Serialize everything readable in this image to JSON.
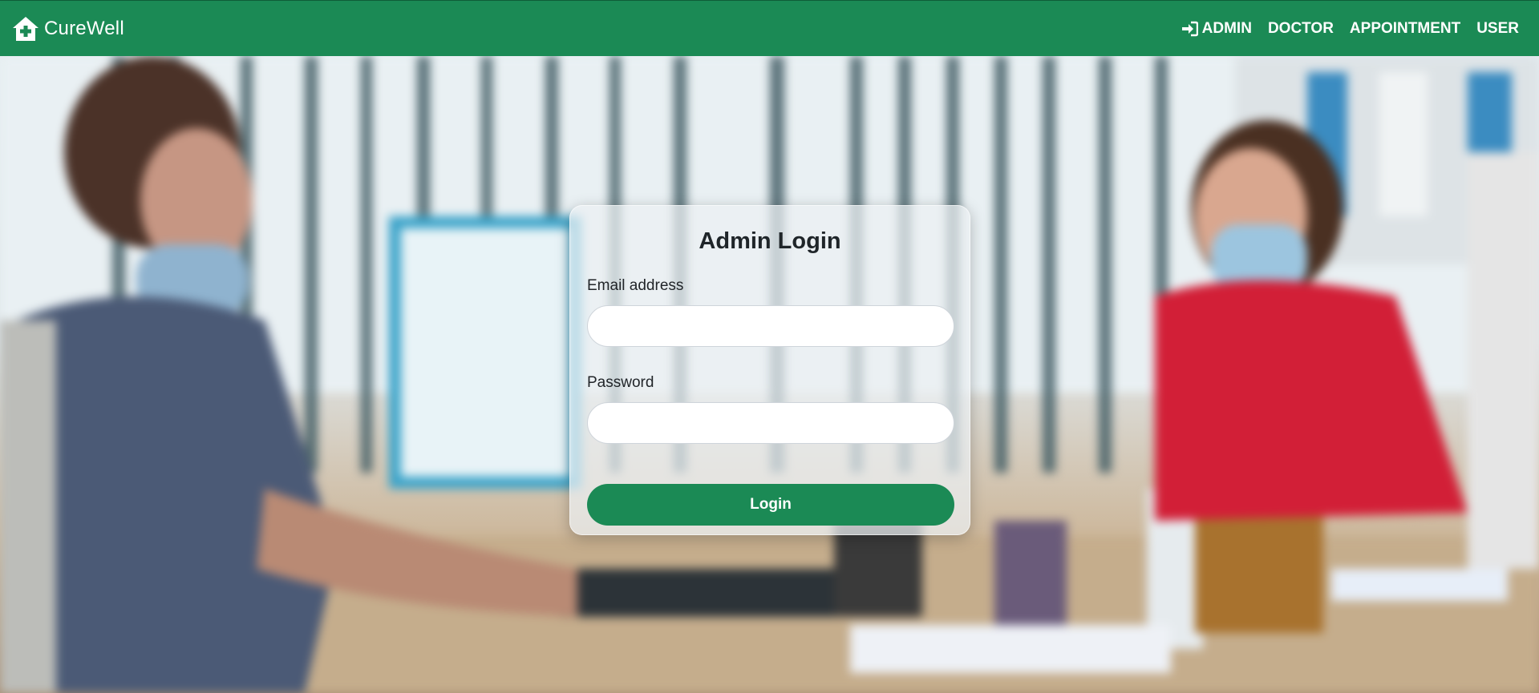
{
  "brand": {
    "name": "CureWell",
    "icon": "home-plus-icon"
  },
  "nav": {
    "items": [
      {
        "label": "ADMIN",
        "icon": "sign-in-icon"
      },
      {
        "label": "DOCTOR"
      },
      {
        "label": "APPOINTMENT"
      },
      {
        "label": "USER"
      }
    ]
  },
  "login": {
    "title": "Admin Login",
    "email_label": "Email address",
    "email_value": "",
    "password_label": "Password",
    "password_value": "",
    "button_label": "Login"
  },
  "colors": {
    "primary": "#1b8a55",
    "text_dark": "#1f2529"
  }
}
